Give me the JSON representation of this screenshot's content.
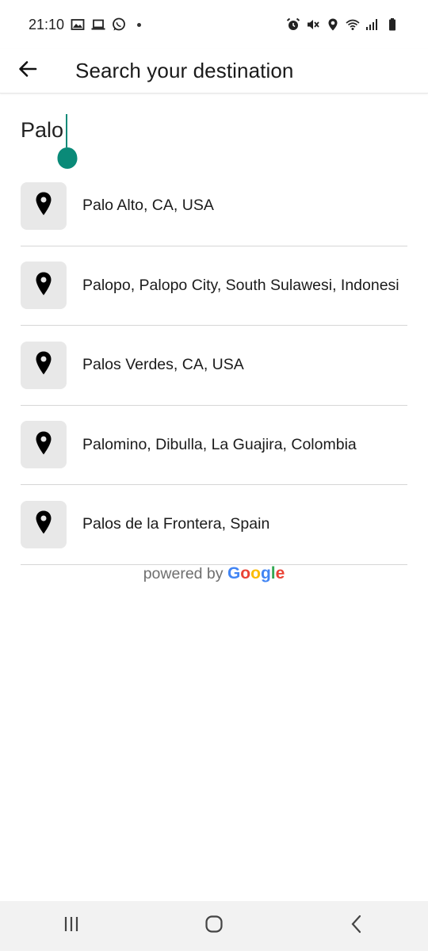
{
  "status_bar": {
    "time": "21:10",
    "left_icons": [
      "image-icon",
      "laptop-icon",
      "whatsapp-icon"
    ],
    "right_icons": [
      "alarm-icon",
      "mute-icon",
      "location-icon",
      "wifi-icon",
      "signal-icon",
      "battery-icon"
    ]
  },
  "app_bar": {
    "title": "Search your destination"
  },
  "search": {
    "value": "Palo"
  },
  "results": [
    {
      "label": "Palo Alto, CA, USA"
    },
    {
      "label": "Palopo, Palopo City, South Sulawesi, Indonesi"
    },
    {
      "label": "Palos Verdes, CA, USA"
    },
    {
      "label": "Palomino, Dibulla, La Guajira, Colombia"
    },
    {
      "label": "Palos de la Frontera, Spain"
    }
  ],
  "attribution": {
    "prefix": "powered by ",
    "brand_letters": [
      "G",
      "o",
      "o",
      "g",
      "l",
      "e"
    ]
  },
  "colors": {
    "accent": "#0a8a78",
    "google_blue": "#4285F4",
    "google_red": "#EA4335",
    "google_yellow": "#FBBC05",
    "google_green": "#34A853"
  }
}
